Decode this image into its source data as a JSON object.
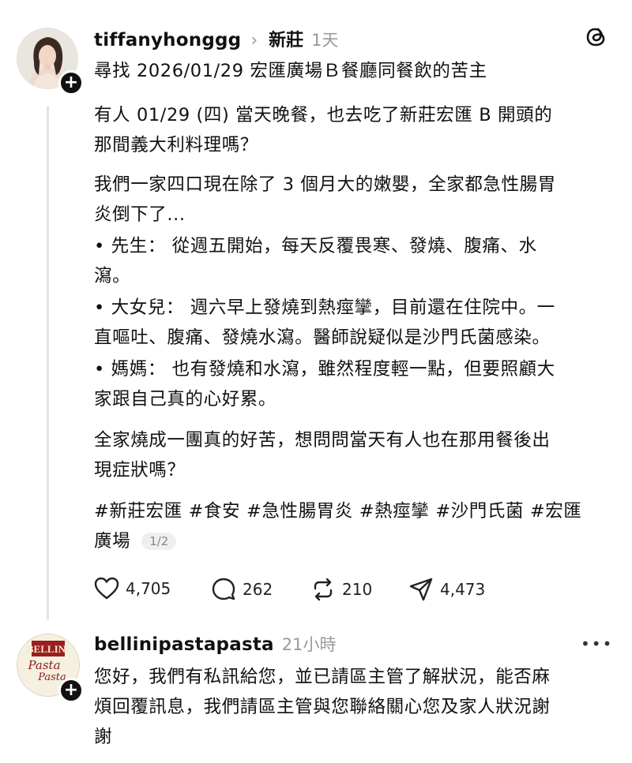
{
  "post": {
    "username": "tiffanyhonggg",
    "location": "新莊",
    "time": "1天",
    "title": "尋找 2026/01/29 宏匯廣場Ｂ餐廳同餐飲的苦主",
    "paragraphs": [
      "有人 01/29 (四) 當天晚餐，也去吃了新莊宏匯 B 開頭的\n那間義大利料理嗎？",
      "我們一家四口現在除了 3 個月大的嫩嬰，全家都急性腸胃\n炎倒下了...",
      "• 先生：  從週五開始，每天反覆畏寒、發燒、腹痛、水\n瀉。",
      "• 大女兒：  週六早上發燒到熱痙攣，目前還在住院中。一\n直嘔吐、腹痛、發燒水瀉。醫師說疑似是沙門氏菌感染。",
      "• 媽媽：  也有發燒和水瀉，雖然程度輕一點，但要照顧大\n家跟自己真的心好累。",
      "全家燒成一團真的好苦，想問問當天有人也在那用餐後出\n現症狀嗎？"
    ],
    "hashtags_line1": "#新莊宏匯 #食安 #急性腸胃炎 #熱痙攣 #沙門氏菌 #宏匯",
    "hashtags_line2": "廣場",
    "page_indicator": "1/2",
    "likes": "4,705",
    "comments": "262",
    "reposts": "210",
    "shares": "4,473"
  },
  "reply": {
    "username": "bellinipastapasta",
    "time": "21小時",
    "text": "您好，我們有私訊給您，並已請區主管了解狀況，能否麻\n煩回覆訊息，我們請區主管與您聯絡關心您及家人狀況謝\n謝",
    "logo_text": "BELLINI Pasta Pasta"
  },
  "icons": {
    "app_logo": "threads-logo-icon",
    "like": "heart-icon",
    "comment": "comment-bubble-icon",
    "repost": "repost-icon",
    "share": "send-icon",
    "more": "more-icon"
  }
}
